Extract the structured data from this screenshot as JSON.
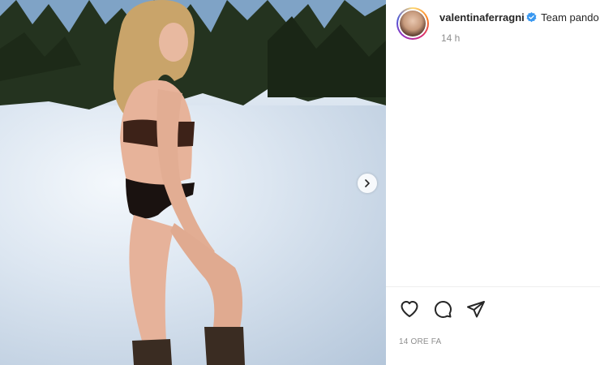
{
  "post": {
    "username": "valentinaferragni",
    "caption": "Team pando",
    "time_short": "14 h",
    "timestamp": "14 ORE FA"
  },
  "icons": {
    "verified": "verified-badge-icon",
    "like": "heart-icon",
    "comment": "comment-bubble-icon",
    "share": "paper-plane-icon",
    "next": "chevron-right-icon"
  },
  "colors": {
    "verified_blue": "#3897f0",
    "text_primary": "#262626",
    "text_secondary": "#8e8e8e"
  }
}
